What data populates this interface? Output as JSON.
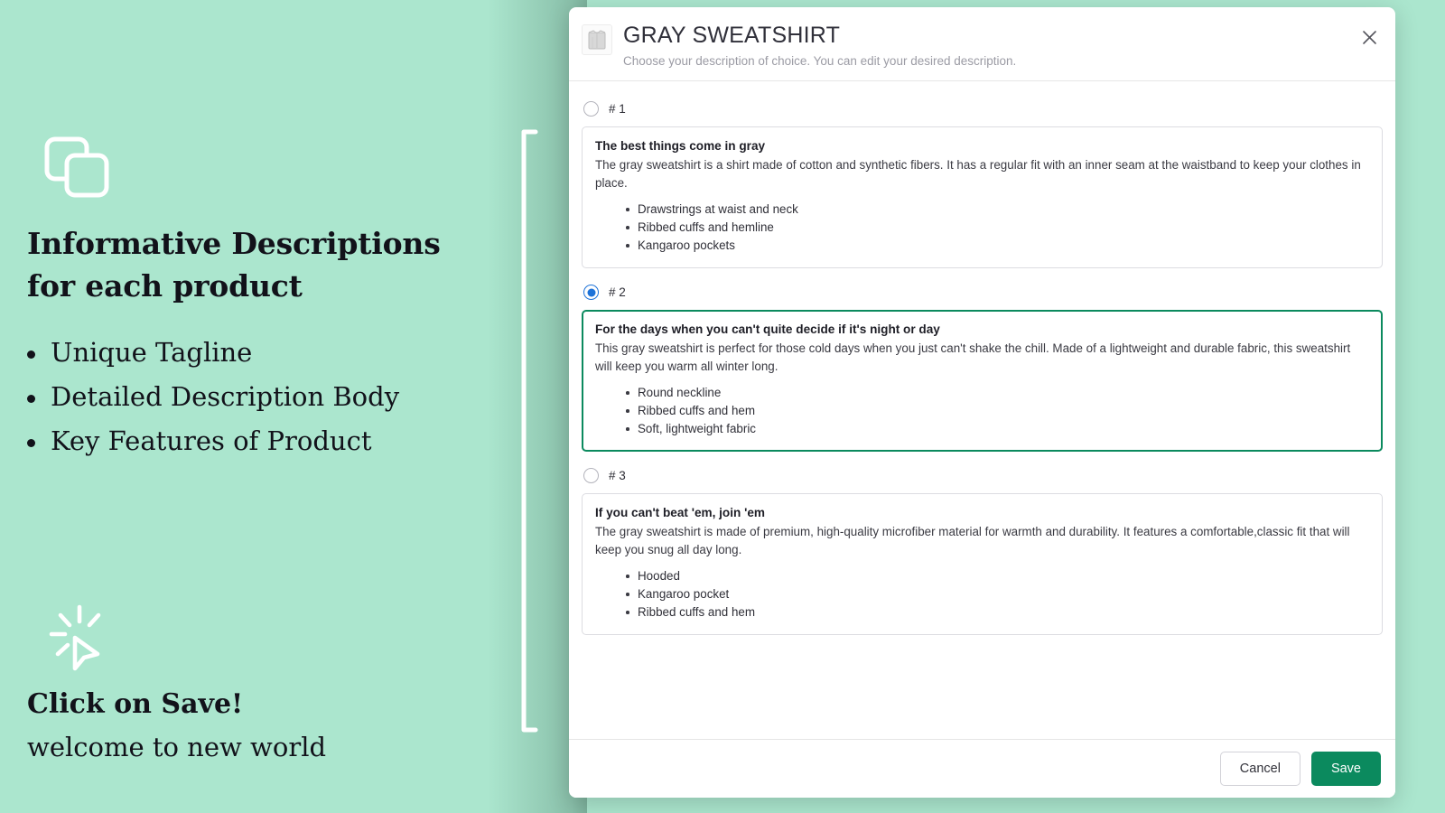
{
  "theme": {
    "background_color": "#ABE6CE",
    "accent_green": "#0b8a5e",
    "radio_selected_blue": "#1d72d8"
  },
  "left_panel": {
    "copy_icon": "copy-stack-icon",
    "headline": "Informative Descriptions for each product",
    "features": [
      "Unique Tagline",
      "Detailed Description Body",
      "Key Features of Product"
    ],
    "cursor_icon": "click-cursor-icon",
    "cta_title": "Click on Save!",
    "cta_subtitle": "welcome to new world",
    "bracket": "bracket-line"
  },
  "modal": {
    "thumbnail_icon": "gray-sweatshirt-thumbnail",
    "title": "GRAY SWEATSHIRT",
    "subtitle": "Choose your description of choice. You can edit your desired description.",
    "close_icon": "close-icon",
    "options": [
      {
        "number": "# 1",
        "selected": false,
        "title": "The best things come in gray",
        "body": "The gray sweatshirt is a shirt made of cotton and synthetic fibers. It has a regular fit with an inner seam at the waistband to keep your clothes in place.",
        "features": [
          "Drawstrings at waist and neck",
          "Ribbed cuffs and hemline",
          "Kangaroo pockets"
        ]
      },
      {
        "number": "# 2",
        "selected": true,
        "title": "For the days when you can't quite decide if it's night or day",
        "body": "This gray sweatshirt is perfect for those cold days when you just can't shake the chill. Made of a lightweight and durable fabric, this sweatshirt will keep you warm all winter long.",
        "features": [
          "Round neckline",
          "Ribbed cuffs and hem",
          "Soft, lightweight fabric"
        ]
      },
      {
        "number": "# 3",
        "selected": false,
        "title": "If you can't beat 'em, join 'em",
        "body": "The gray sweatshirt is made of premium, high-quality microfiber material for warmth and durability. It features a comfortable,classic fit that will keep you snug all day long.",
        "features": [
          "Hooded",
          "Kangaroo pocket",
          "Ribbed cuffs and hem"
        ]
      }
    ],
    "footer": {
      "cancel_label": "Cancel",
      "save_label": "Save"
    }
  }
}
